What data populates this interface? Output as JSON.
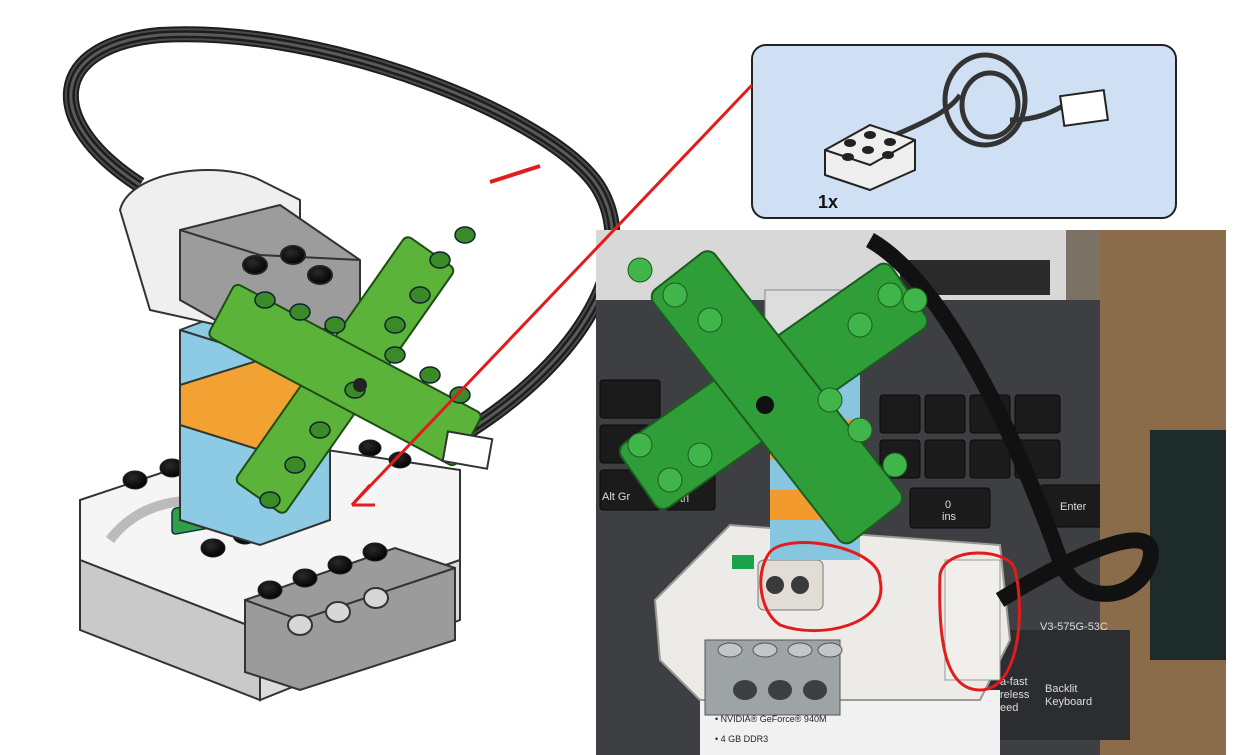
{
  "inset": {
    "quantity_label": "1x"
  },
  "photo": {
    "key_alt": "Alt Gr",
    "key_ctrl": "Ctrl",
    "key_ins": "ins",
    "key_zero": "0",
    "key_enter": "Enter",
    "keyboard_label_1": "a-fast",
    "keyboard_label_2": "reless",
    "keyboard_label_3": "eed",
    "keyboard_label_4": "Backlit",
    "keyboard_label_5": "Keyboard",
    "model_text": "V3-575G-53C",
    "spec_line_1": "• NVIDIA® GeForce® 940M",
    "spec_line_2": "• 4 GB DDR3"
  },
  "colors": {
    "green_brick": "#5cb33a",
    "green_dark": "#2f7d1f",
    "blue_brick": "#8ccbe3",
    "orange_brick": "#f2a232",
    "red_annotation": "#e21c1c",
    "inset_bg": "#cfe0f5"
  }
}
